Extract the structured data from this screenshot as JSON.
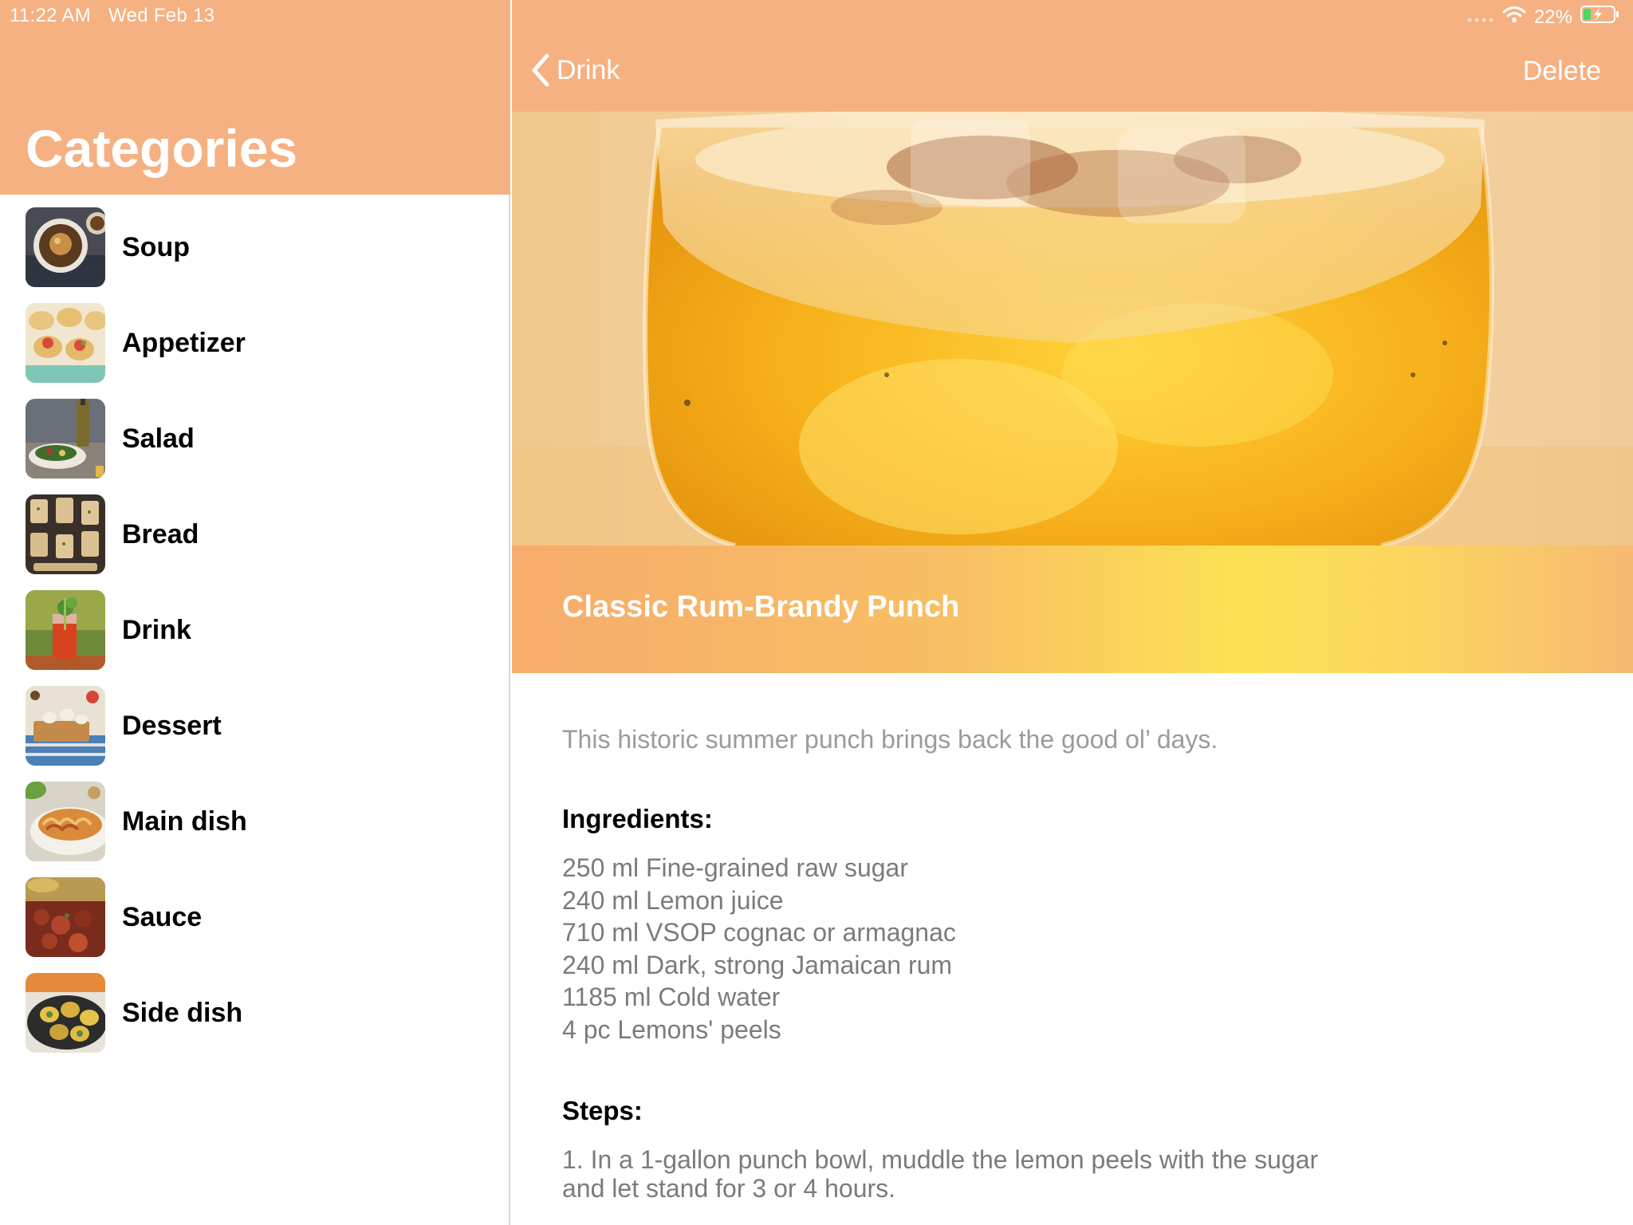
{
  "status_bar": {
    "time": "11:22 AM",
    "date": "Wed Feb 13",
    "battery": "22%"
  },
  "master": {
    "title": "Categories",
    "categories": [
      {
        "label": "Soup",
        "icon": "soup-thumbnail"
      },
      {
        "label": "Appetizer",
        "icon": "appetizer-thumbnail"
      },
      {
        "label": "Salad",
        "icon": "salad-thumbnail"
      },
      {
        "label": "Bread",
        "icon": "bread-thumbnail"
      },
      {
        "label": "Drink",
        "icon": "drink-thumbnail"
      },
      {
        "label": "Dessert",
        "icon": "dessert-thumbnail"
      },
      {
        "label": "Main dish",
        "icon": "main-dish-thumbnail"
      },
      {
        "label": "Sauce",
        "icon": "sauce-thumbnail"
      },
      {
        "label": "Side dish",
        "icon": "side-dish-thumbnail"
      }
    ]
  },
  "detail": {
    "back_label": "Drink",
    "delete_label": "Delete",
    "recipe_title": "Classic Rum-Brandy Punch",
    "description": "This historic summer punch brings back the good ol’ days.",
    "ingredients_heading": "Ingredients:",
    "ingredients": [
      "250 ml Fine-grained raw sugar",
      "240 ml Lemon juice",
      "710 ml VSOP cognac or armagnac",
      "240 ml Dark, strong Jamaican rum",
      "1185 ml Cold water",
      "4 pc Lemons' peels"
    ],
    "steps_heading": "Steps:",
    "steps_text": "1. In a 1-gallon punch bowl, muddle the lemon peels with the sugar and let stand for 3 or 4 hours."
  },
  "colors": {
    "accent": "#f5b182",
    "primary_text": "#000000",
    "secondary_text": "#9b9b9b",
    "body_text": "#7b7b7b"
  }
}
